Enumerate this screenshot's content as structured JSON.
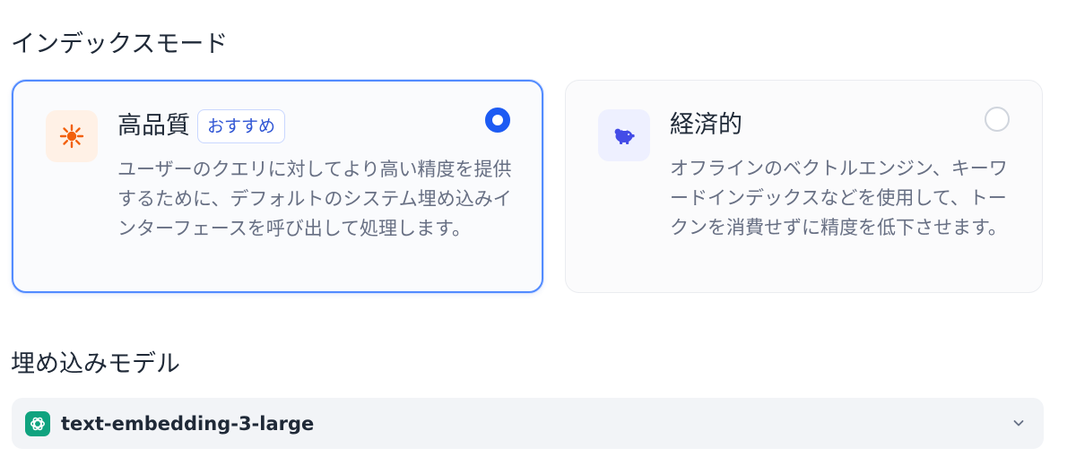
{
  "index_mode": {
    "title": "インデックスモード",
    "options": [
      {
        "title": "高品質",
        "badge": "おすすめ",
        "description": "ユーザーのクエリに対してより高い精度を提供するために、デフォルトのシステム埋め込みインターフェースを呼び出して処理します。",
        "selected": true,
        "icon": "sun-icon",
        "icon_color": "#f2600c"
      },
      {
        "title": "経済的",
        "description": "オフラインのベクトルエンジン、キーワードインデックスなどを使用して、トークンを消費せずに精度を低下させます。",
        "selected": false,
        "icon": "piggy-bank-icon",
        "icon_color": "#444ce7"
      }
    ]
  },
  "embedding_model": {
    "title": "埋め込みモデル",
    "selected_model": "text-embedding-3-large",
    "icon": "openai-icon",
    "icon_color": "#10a37f"
  },
  "colors": {
    "accent": "#1d5bf3",
    "selected_border": "#528bff"
  }
}
